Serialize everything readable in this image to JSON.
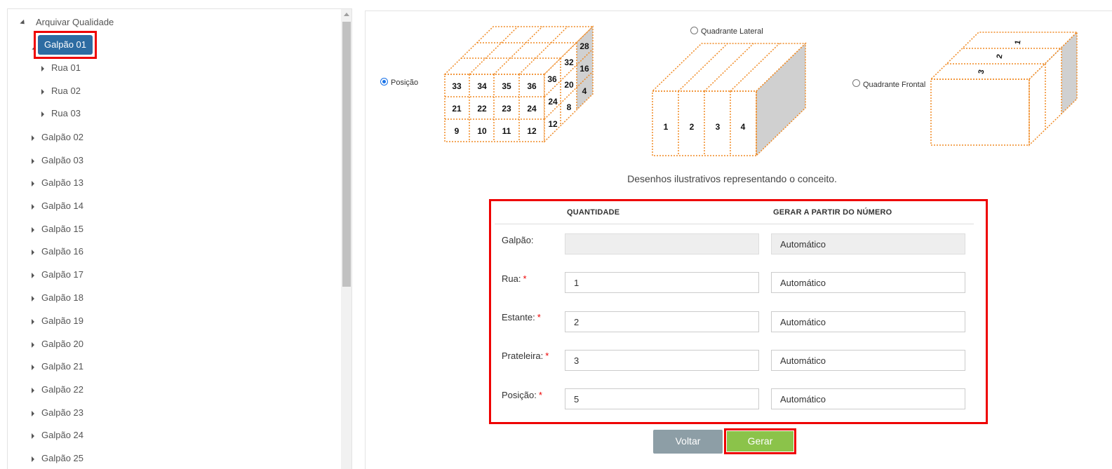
{
  "tree": {
    "root": {
      "label": "Arquivar Qualidade"
    },
    "selected": {
      "label": "Galpão 01"
    },
    "children": [
      {
        "label": "Rua 01"
      },
      {
        "label": "Rua 02"
      },
      {
        "label": "Rua 03"
      }
    ],
    "siblings": [
      {
        "label": "Galpão 02"
      },
      {
        "label": "Galpão 03"
      },
      {
        "label": "Galpão 13"
      },
      {
        "label": "Galpão 14"
      },
      {
        "label": "Galpão 15"
      },
      {
        "label": "Galpão 16"
      },
      {
        "label": "Galpão 17"
      },
      {
        "label": "Galpão 18"
      },
      {
        "label": "Galpão 19"
      },
      {
        "label": "Galpão 20"
      },
      {
        "label": "Galpão 21"
      },
      {
        "label": "Galpão 22"
      },
      {
        "label": "Galpão 23"
      },
      {
        "label": "Galpão 24"
      },
      {
        "label": "Galpão 25"
      }
    ]
  },
  "options": {
    "posicao": {
      "label": "Posição",
      "checked": true
    },
    "lateral": {
      "label": "Quadrante Lateral",
      "checked": false
    },
    "frontal": {
      "label": "Quadrante Frontal",
      "checked": false
    }
  },
  "illustration": {
    "position_front": [
      [
        "33",
        "34",
        "35",
        "36"
      ],
      [
        "21",
        "22",
        "23",
        "24"
      ],
      [
        "9",
        "10",
        "11",
        "12"
      ]
    ],
    "position_side": [
      "28",
      "32",
      "16",
      "36",
      "20",
      "4",
      "24",
      "8",
      "12"
    ],
    "lateral_numbers": [
      "1",
      "2",
      "3",
      "4"
    ],
    "frontal_numbers": [
      "1",
      "2",
      "3"
    ],
    "caption": "Desenhos ilustrativos representando o conceito."
  },
  "form": {
    "col_quantity": "QUANTIDADE",
    "col_start": "GERAR A PARTIR DO NÚMERO",
    "rows": [
      {
        "label": "Galpão:",
        "required": false,
        "quantity": "",
        "start": "Automático",
        "disabled": true
      },
      {
        "label": "Rua:",
        "required": true,
        "quantity": "1",
        "start": "Automático",
        "disabled": false
      },
      {
        "label": "Estante:",
        "required": true,
        "quantity": "2",
        "start": "Automático",
        "disabled": false
      },
      {
        "label": "Prateleira:",
        "required": true,
        "quantity": "3",
        "start": "Automático",
        "disabled": false
      },
      {
        "label": "Posição:",
        "required": true,
        "quantity": "5",
        "start": "Automático",
        "disabled": false
      }
    ],
    "required_mark": "*"
  },
  "buttons": {
    "back": "Voltar",
    "generate": "Gerar"
  },
  "colors": {
    "accent_blue": "#2d6ca2",
    "highlight_red": "#ee0000",
    "generate_green": "#8bc34a",
    "back_gray": "#8d9ea6",
    "cube_orange": "#f08a24"
  }
}
